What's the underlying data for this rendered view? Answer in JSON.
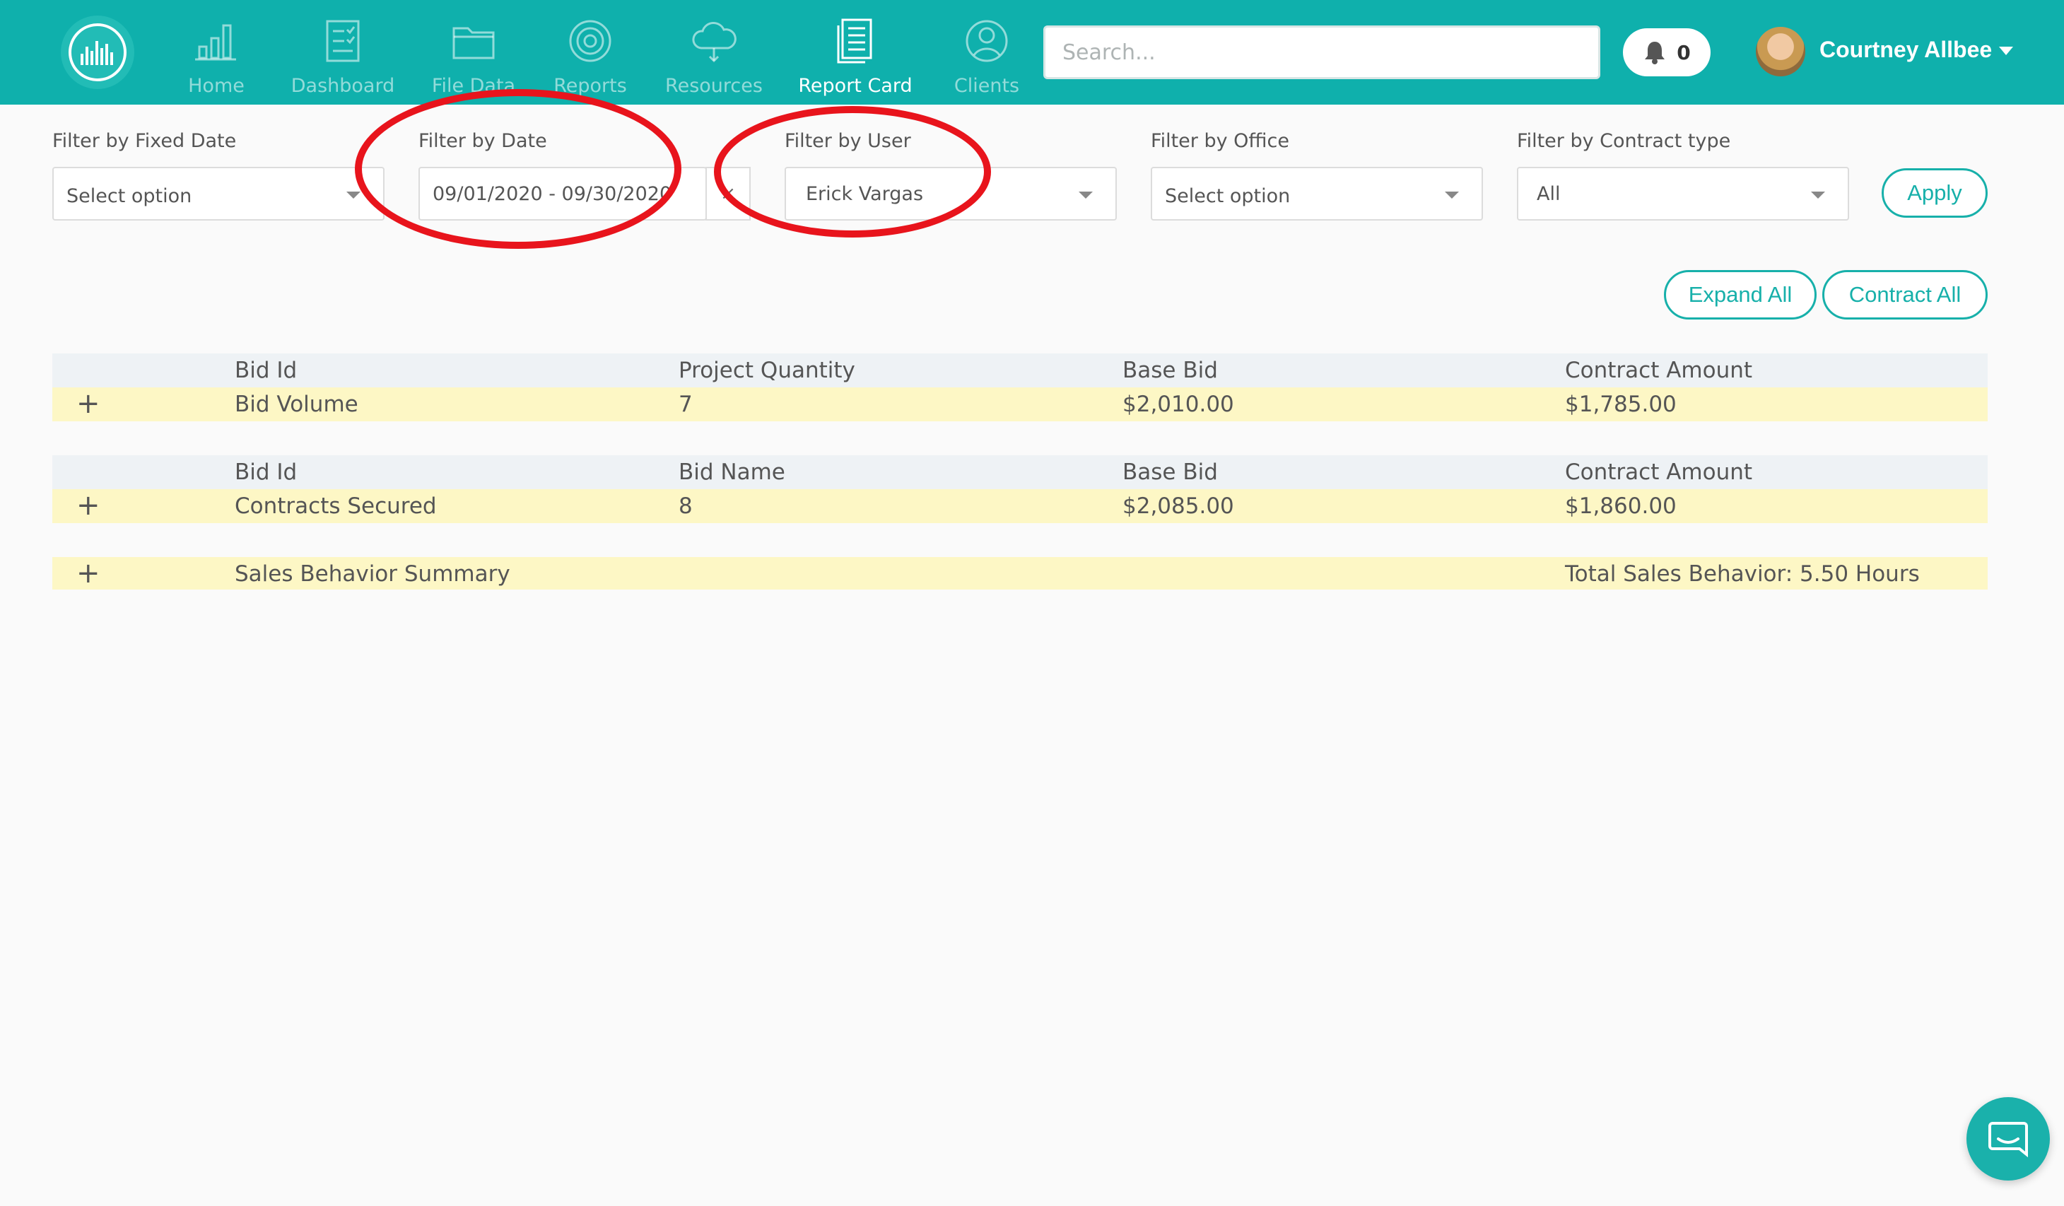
{
  "nav": {
    "items": [
      {
        "label": "Home",
        "icon": "bar-chart-icon"
      },
      {
        "label": "Dashboard",
        "icon": "checklist-icon"
      },
      {
        "label": "File Data",
        "icon": "folder-icon"
      },
      {
        "label": "Reports",
        "icon": "target-icon"
      },
      {
        "label": "Resources",
        "icon": "cloud-icon"
      },
      {
        "label": "Report Card",
        "icon": "document-icon"
      },
      {
        "label": "Clients",
        "icon": "user-circle-icon"
      }
    ],
    "active": "Report Card"
  },
  "search": {
    "placeholder": "Search..."
  },
  "notifications": {
    "count": "0"
  },
  "user": {
    "name": "Courtney Allbee"
  },
  "filters": {
    "fixed_date": {
      "label": "Filter by Fixed Date",
      "value": "Select option"
    },
    "date": {
      "label": "Filter by Date",
      "value": "09/01/2020 - 09/30/2020",
      "clear": "×"
    },
    "user": {
      "label": "Filter by User",
      "value": "Erick Vargas"
    },
    "office": {
      "label": "Filter by Office",
      "value": "Select option"
    },
    "contract_type": {
      "label": "Filter by Contract type",
      "value": "All"
    },
    "apply_label": "Apply"
  },
  "actions": {
    "expand_all": "Expand All",
    "contract_all": "Contract All"
  },
  "tables": {
    "bid_volume": {
      "headers": [
        "Bid Id",
        "Project Quantity",
        "Base Bid",
        "Contract Amount"
      ],
      "row": [
        "Bid Volume",
        "7",
        "$2,010.00",
        "$1,785.00"
      ]
    },
    "contracts_secured": {
      "headers": [
        "Bid Id",
        "Bid Name",
        "Base Bid",
        "Contract Amount"
      ],
      "row": [
        "Contracts Secured",
        "8",
        "$2,085.00",
        "$1,860.00"
      ]
    },
    "sales_behavior": {
      "title": "Sales Behavior Summary",
      "total": "Total Sales Behavior: 5.50 Hours"
    }
  },
  "expand_symbol": "+",
  "colors": {
    "brand": "#0fb0ac",
    "row_highlight": "#fdf7c5",
    "header_row": "#eef2f5",
    "annotation": "#e8141c"
  }
}
